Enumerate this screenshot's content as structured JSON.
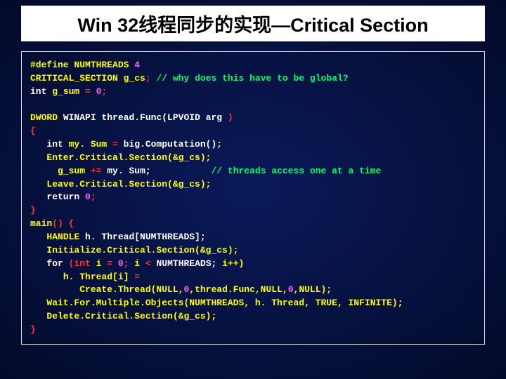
{
  "title": "Win 32线程同步的实现—Critical Section",
  "code": {
    "l01_define": "#define",
    "l01_macro": "NUMTHREADS",
    "l01_val": "4",
    "l02_type": "CRITICAL_SECTION",
    "l02_var": "g_cs",
    "l02_semi": ";",
    "l02_comment": "// why does this have to be global?",
    "l03_a": "int ",
    "l03_b": "g_sum",
    "l03_c": " = ",
    "l03_d": "0",
    "l03_e": ";",
    "blank1": " ",
    "l05_a": "DWORD",
    "l05_b": " WINAPI ",
    "l05_c": "thread.Func(LPVOID",
    "l05_d": " arg ",
    "l05_e": ")",
    "l06": "{",
    "l07_a": "   int ",
    "l07_b": "my. Sum",
    "l07_c": " = ",
    "l07_d": "big.Computation();",
    "l08_a": "   ",
    "l08_b": "Enter.Critical.Section(&g_cs);",
    "l09_a": "     ",
    "l09_b": "g_sum",
    "l09_c": " += ",
    "l09_d": "my. Sum;",
    "l09_pad": "           ",
    "l09_comment": "// threads access one at a time",
    "l10_a": "   ",
    "l10_b": "Leave.Critical.Section(&g_cs);",
    "l11_a": "   return ",
    "l11_b": "0",
    "l11_c": ";",
    "l12": "}",
    "l13_a": "main",
    "l13_b": "() {",
    "l14_a": "   ",
    "l14_b": "HANDLE",
    "l14_c": " ",
    "l14_d": "h. Thread[NUMTHREADS];",
    "l15_a": "   ",
    "l15_b": "Initialize.Critical.Section(&g_cs);",
    "l16_a": "   for ",
    "l16_b": "(int ",
    "l16_c": "i",
    "l16_d": " = ",
    "l16_e": "0",
    "l16_f": "; ",
    "l16_g": "i",
    "l16_h": " < ",
    "l16_i": "NUMTHREADS; ",
    "l16_j": "i++)",
    "l17_a": "      ",
    "l17_b": "h. Thread[i]",
    "l17_c": " = ",
    "l18_a": "         ",
    "l18_b": "Create.Thread(NULL,",
    "l18_c": "0",
    "l18_d": ",thread.Func,NULL,",
    "l18_e": "0",
    "l18_f": ",NULL);",
    "l19_a": "   ",
    "l19_b": "Wait.For.Multiple.Objects(NUMTHREADS, h. Thread, TRUE, INFINITE);",
    "l20_a": "   ",
    "l20_b": "Delete.Critical.Section(&g_cs);",
    "l21": "}"
  }
}
